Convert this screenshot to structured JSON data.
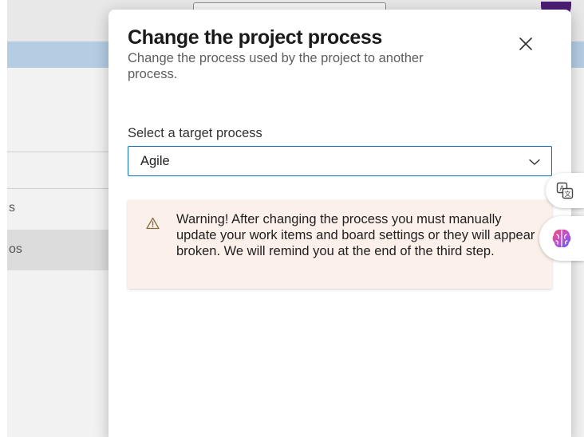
{
  "background": {
    "list_items": [
      "s",
      "os"
    ]
  },
  "dialog": {
    "title": "Change the project process",
    "subtitle": "Change the process used by the project to another process.",
    "close_icon": "close-icon",
    "field_label": "Select a target process",
    "select": {
      "value": "Agile",
      "icon": "chevron-down-icon"
    },
    "warning": {
      "icon": "warning-triangle-icon",
      "text": "Warning! After changing the process you must manually update your work items and board settings or they will appear broken. We will remind you at the end of the third step."
    }
  },
  "side_buttons": {
    "translate_icon": "translate-icon",
    "brain_icon": "brain-icon"
  },
  "colors": {
    "accent": "#0f6cbd",
    "warning_bg": "#fbf0ea",
    "warning_icon": "#b36b00",
    "avatar": "#4b1d74"
  }
}
